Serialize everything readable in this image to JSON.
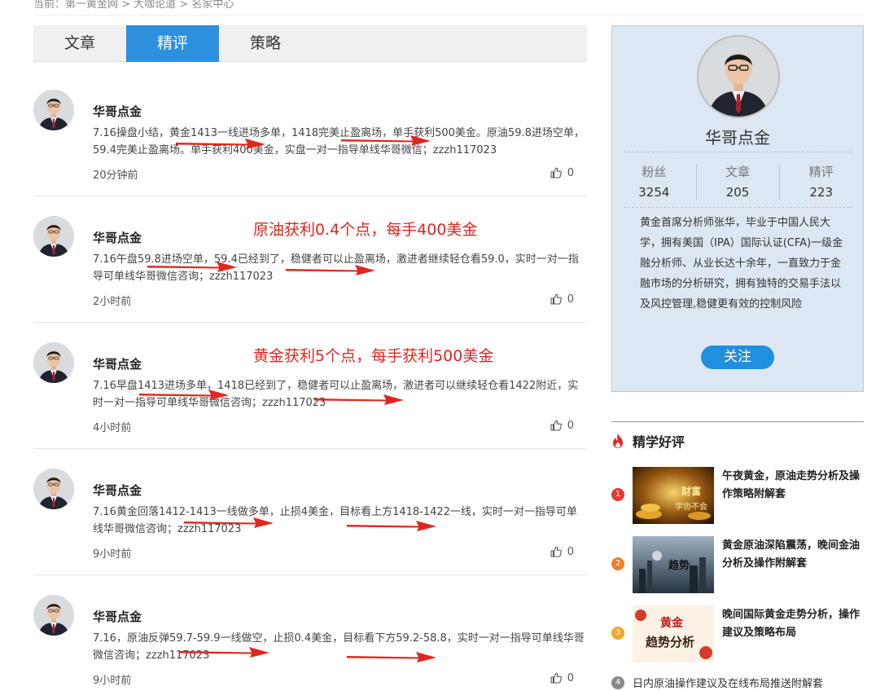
{
  "breadcrumb": "当前：第一黄金网 > 大咖论道 > 名家中心",
  "tabs": [
    {
      "label": "文章",
      "active": false
    },
    {
      "label": "精评",
      "active": true
    },
    {
      "label": "策略",
      "active": false
    }
  ],
  "posts": [
    {
      "author": "华哥点金",
      "content": "7.16操盘小结，黄金1413一线进场多单，1418完美止盈离场，单手获利500美金。原油59.8进场空单，59.4完美止盈离场。单手获利400美金，实盘一对一指导单线华哥微信；zzzh117023",
      "time": "20分钟前",
      "likes": "0",
      "annotation": ""
    },
    {
      "author": "华哥点金",
      "content": "7.16午盘59.8进场空单，59.4已经到了，稳健者可以止盈离场，激进者继续轻仓看59.0，实时一对一指导可单线华哥微信咨询；zzzh117023",
      "time": "2小时前",
      "likes": "0",
      "annotation": "原油获利0.4个点，每手400美金"
    },
    {
      "author": "华哥点金",
      "content": "7.16早盘1413进场多单，1418已经到了，稳健者可以止盈离场，激进者可以继续轻仓看1422附近，实时一对一指导可单线华哥微信咨询；zzzh117023",
      "time": "4小时前",
      "likes": "0",
      "annotation": "黄金获利5个点，每手获利500美金"
    },
    {
      "author": "华哥点金",
      "content": "7.16黄金回落1412-1413一线做多单，止损4美金，目标看上方1418-1422一线，实时一对一指导可单线华哥微信咨询；zzzh117023",
      "time": "9小时前",
      "likes": "0",
      "annotation": ""
    },
    {
      "author": "华哥点金",
      "content": "7.16，原油反弹59.7-59.9一线做空，止损0.4美金，目标看下方59.2-58.8，实时一对一指导可单线华哥微信咨询；zzzh117023",
      "time": "9小时前",
      "likes": "0",
      "annotation": ""
    }
  ],
  "profile": {
    "name": "华哥点金",
    "stats": [
      {
        "label": "粉丝",
        "value": "3254"
      },
      {
        "label": "文章",
        "value": "205"
      },
      {
        "label": "精评",
        "value": "223"
      }
    ],
    "bio": "黄金首席分析师张华，毕业于中国人民大学，拥有美国（IPA）国际认证(CFA)一级金融分析师、从业长达十余年，一直致力于金融市场的分析研究，拥有独特的交易手法以及风控管理,稳健更有效的控制风险",
    "follow_label": "关注"
  },
  "recommend": {
    "title": "精学好评",
    "items": [
      {
        "num": "1",
        "title": "午夜黄金，原油走势分析及操作策略附解套",
        "thumb_text": "财富 学协不会",
        "color": "#e8392f"
      },
      {
        "num": "2",
        "title": "黄金原油深陷震荡，晚间金油分析及操作附解套",
        "thumb_text": "趋势",
        "color": "#f07d2b"
      },
      {
        "num": "3",
        "title": "晚间国际黄金走势分析，操作建议及策略布局",
        "thumb_text": "黄金 趋势分析",
        "color": "#f0a72b"
      }
    ],
    "item4": {
      "num": "4",
      "title": "日内原油操作建议及在线布局推送附解套"
    }
  },
  "colors": {
    "accent": "#2e8fdc",
    "annotation": "#e0261f",
    "profile_bg": "#dde7f3"
  }
}
